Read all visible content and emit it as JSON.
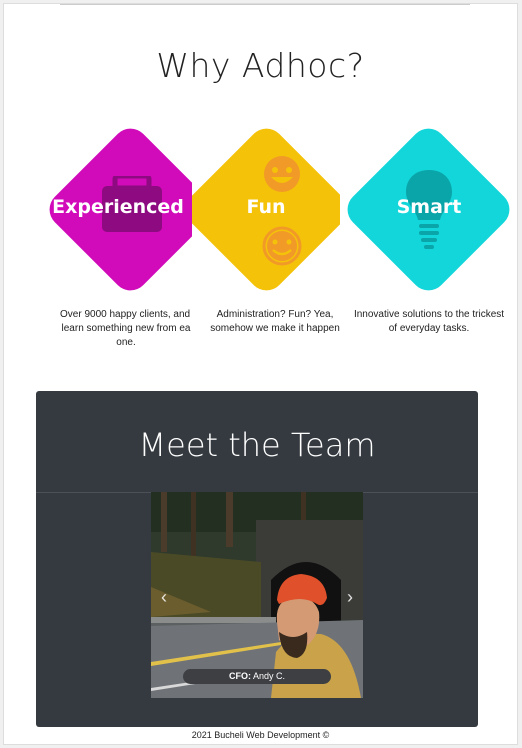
{
  "heading": "Why Adhoc?",
  "cards": [
    {
      "label": "Experienced",
      "icon": "briefcase-icon",
      "color": "#d10aba",
      "text_lines": [
        "Over 9000 happy clients, and w",
        "learn something new from ea",
        "one."
      ]
    },
    {
      "label": "Fun",
      "icon": "smiley-icon",
      "color": "#f5c20a",
      "text_lines": [
        "Administration? Fun? Yea,",
        "somehow we make it happen"
      ]
    },
    {
      "label": "Smart",
      "icon": "lightbulb-icon",
      "color": "#12d6da",
      "text_lines": [
        "Innovative solutions to the trickest",
        "of everyday tasks."
      ]
    }
  ],
  "team": {
    "title": "Meet the Team",
    "caption_role": "CFO:",
    "caption_name": "Andy C.",
    "prev_icon": "‹",
    "next_icon": "›"
  },
  "footer": "2021 Bucheli Web Development ©"
}
